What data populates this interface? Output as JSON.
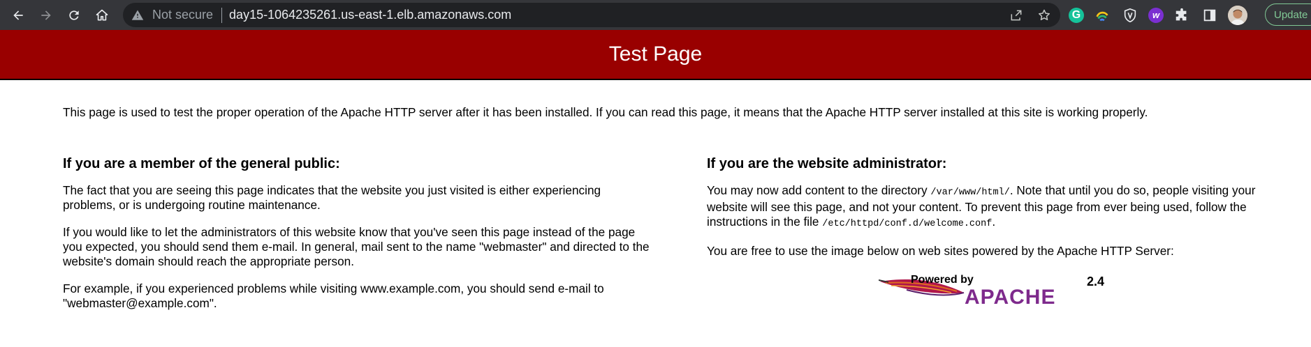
{
  "browser": {
    "security_label": "Not secure",
    "url": "day15-1064235261.us-east-1.elb.amazonaws.com",
    "update_label": "Update",
    "grammarly_glyph": "G",
    "w_ext_glyph": "w"
  },
  "page": {
    "title": "Test Page",
    "intro": "This page is used to test the proper operation of the Apache HTTP server after it has been installed. If you can read this page, it means that the Apache HTTP server installed at this site is working properly.",
    "public": {
      "heading": "If you are a member of the general public:",
      "p1": "The fact that you are seeing this page indicates that the website you just visited is either experiencing problems, or is undergoing routine maintenance.",
      "p2": "If you would like to let the administrators of this website know that you've seen this page instead of the page you expected, you should send them e-mail. In general, mail sent to the name \"webmaster\" and directed to the website's domain should reach the appropriate person.",
      "p3": "For example, if you experienced problems while visiting www.example.com, you should send e-mail to \"webmaster@example.com\"."
    },
    "admin": {
      "heading": "If you are the website administrator:",
      "p1_a": "You may now add content to the directory ",
      "p1_code1": "/var/www/html/",
      "p1_b": ". Note that until you do so, people visiting your website will see this page, and not your content. To prevent this page from ever being used, follow the instructions in the file ",
      "p1_code2": "/etc/httpd/conf.d/welcome.conf",
      "p1_c": ".",
      "p2": "You are free to use the image below on web sites powered by the Apache HTTP Server:"
    },
    "logo": {
      "powered_by": "Powered by",
      "brand": "APACHE",
      "version": "2.4"
    }
  },
  "colors": {
    "banner": "#990000",
    "toolbar": "#35363a",
    "omnibox": "#202124"
  }
}
